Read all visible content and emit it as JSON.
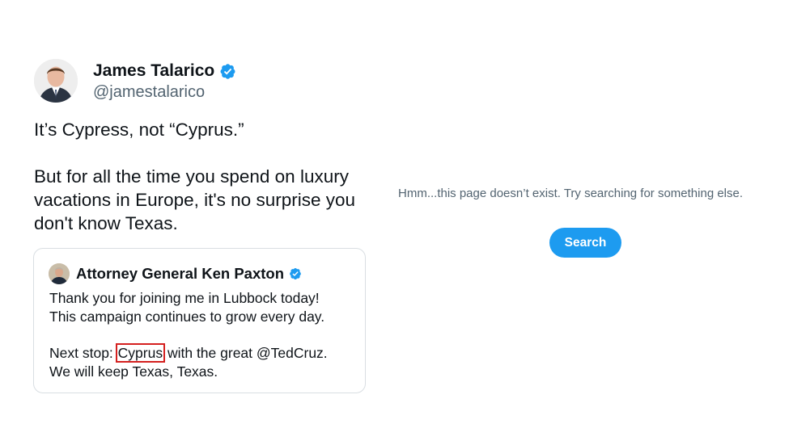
{
  "tweet": {
    "author_name": "James Talarico",
    "author_handle": "@jamestalarico",
    "verified_icon": "verified-badge-icon",
    "text_line1": "It’s Cypress, not “Cyprus.”",
    "text_para2": "But for all the time you spend on luxury vacations in Europe, it's no surprise you don't know Texas."
  },
  "quoted_tweet": {
    "author_name": "Attorney General Ken Paxton",
    "verified_icon": "verified-badge-icon",
    "line1": "Thank you for joining me in Lubbock today!",
    "line2": "This campaign continues to grow every day.",
    "line3_before": "Next stop: ",
    "line3_highlight": "Cyprus",
    "line3_after": " with the great @TedCruz.",
    "line4": "We will keep Texas, Texas."
  },
  "error_page": {
    "message": "Hmm...this page doesn’t exist. Try searching for something else.",
    "search_label": "Search"
  },
  "colors": {
    "accent": "#1d9bf0",
    "highlight_box": "#d4201f",
    "secondary_text": "#536471"
  }
}
